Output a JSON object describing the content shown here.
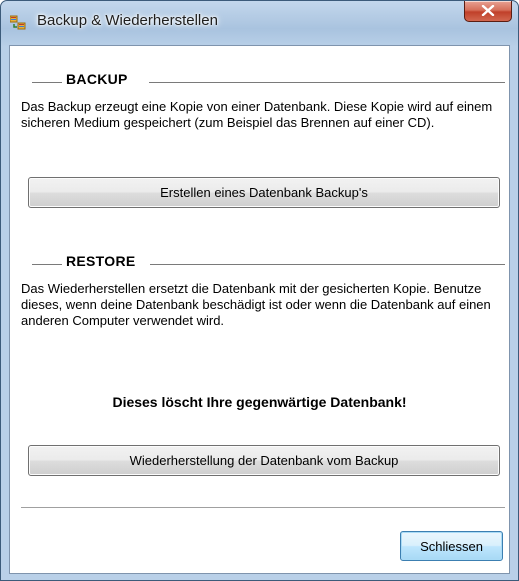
{
  "window": {
    "title": "Backup & Wiederherstellen"
  },
  "backup": {
    "heading": "BACKUP",
    "description": "Das Backup erzeugt eine Kopie von einer Datenbank. Diese Kopie wird auf einem sicheren Medium gespeichert (zum Beispiel das Brennen auf einer CD).",
    "button_label": "Erstellen eines Datenbank Backup's"
  },
  "restore": {
    "heading": "RESTORE",
    "description": "Das Wiederherstellen ersetzt die Datenbank mit der gesicherten Kopie. Benutze dieses, wenn deine Datenbank beschädigt ist oder wenn die Datenbank auf einen anderen Computer verwendet wird.",
    "warning": "Dieses löscht Ihre gegenwärtige Datenbank!",
    "button_label": "Wiederherstellung der Datenbank vom Backup"
  },
  "footer": {
    "close_label": "Schliessen"
  },
  "icons": {
    "app": "database-backup-icon",
    "close": "close-icon"
  },
  "colors": {
    "close_button": "#c0402a",
    "title_bar": "#a9c3df"
  }
}
